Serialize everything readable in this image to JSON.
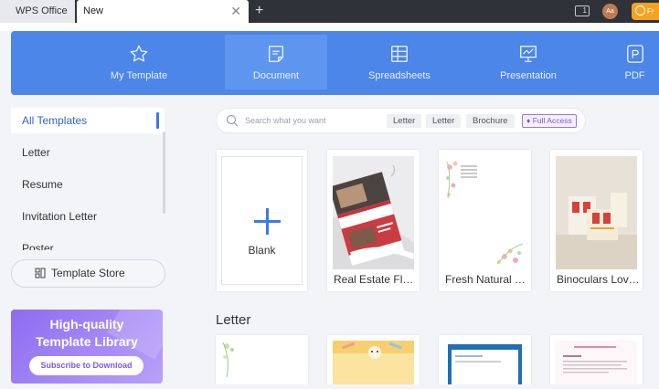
{
  "titlebar": {
    "app_tab": "WPS Office",
    "doc_tab": "New",
    "close_glyph": "✕",
    "add_glyph": "+",
    "window_counter": "1",
    "avatar_initials": "Aa",
    "badge_text": "Fr"
  },
  "categories": [
    {
      "label": "My Template",
      "icon": "star-icon"
    },
    {
      "label": "Document",
      "icon": "document-icon"
    },
    {
      "label": "Spreadsheets",
      "icon": "spreadsheet-icon"
    },
    {
      "label": "Presentation",
      "icon": "presentation-icon"
    },
    {
      "label": "PDF",
      "icon": "pdf-icon"
    }
  ],
  "active_category": "Document",
  "sidebar": {
    "items": [
      {
        "label": "All Templates"
      },
      {
        "label": "Letter"
      },
      {
        "label": "Resume"
      },
      {
        "label": "Invitation Letter"
      },
      {
        "label": "Poster"
      }
    ],
    "store_button": "Template Store",
    "promo": {
      "line1": "High-quality",
      "line2": "Template Library",
      "button": "Subscribe to Download"
    }
  },
  "search": {
    "placeholder": "Search what you want",
    "chips": [
      "Letter",
      "Letter",
      "Brochure"
    ],
    "access_chip": "Full Access"
  },
  "templates": [
    {
      "name": "Blank"
    },
    {
      "name": "Real Estate Flyer"
    },
    {
      "name": "Fresh Natural T..."
    },
    {
      "name": "Binoculars Love..."
    }
  ],
  "section": {
    "title": "Letter"
  },
  "colors": {
    "accent": "#4b86e8",
    "promo": "#8d6cf0",
    "badge": "#f7a21e"
  }
}
